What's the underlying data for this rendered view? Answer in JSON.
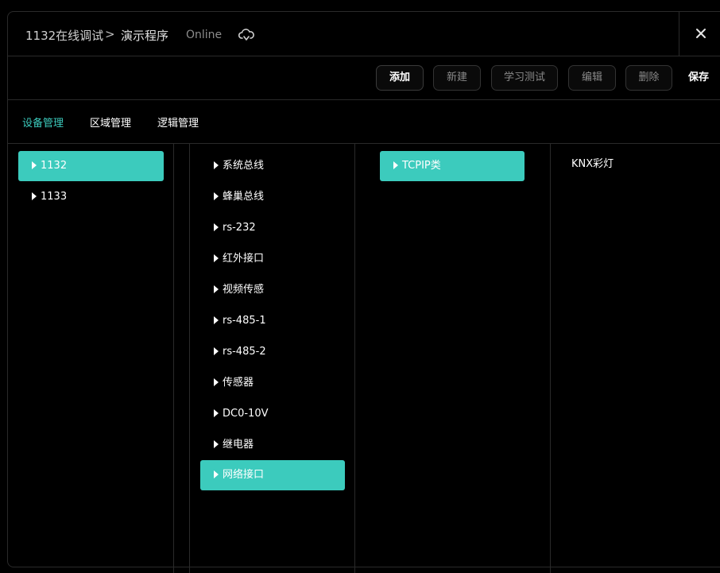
{
  "header": {
    "breadcrumb_root": "1132在线调试",
    "breadcrumb_sep": ">",
    "breadcrumb_current": "演示程序",
    "status": "Online",
    "icons": {
      "cloud": "cloud-sync-icon",
      "close": "close-icon"
    }
  },
  "toolbar": {
    "add": "添加",
    "new": "新建",
    "learn_test": "学习测试",
    "edit": "编辑",
    "delete": "删除",
    "save": "保存"
  },
  "tabs": [
    {
      "label": "设备管理",
      "active": true
    },
    {
      "label": "区域管理",
      "active": false
    },
    {
      "label": "逻辑管理",
      "active": false
    }
  ],
  "columns": {
    "hosts": [
      {
        "label": "1132",
        "selected": true
      },
      {
        "label": "1133",
        "selected": false
      }
    ],
    "interfaces": [
      {
        "label": "系统总线",
        "selected": false
      },
      {
        "label": "蜂巢总线",
        "selected": false
      },
      {
        "label": "rs-232",
        "selected": false
      },
      {
        "label": "红外接口",
        "selected": false
      },
      {
        "label": "视频传感",
        "selected": false
      },
      {
        "label": "rs-485-1",
        "selected": false
      },
      {
        "label": "rs-485-2",
        "selected": false
      },
      {
        "label": "传感器",
        "selected": false
      },
      {
        "label": "DC0-10V",
        "selected": false
      },
      {
        "label": "继电器",
        "selected": false
      },
      {
        "label": "网络接口",
        "selected": true
      }
    ],
    "categories": [
      {
        "label": "TCPIP类",
        "selected": true
      }
    ],
    "devices": [
      {
        "label": "KNX彩灯",
        "selected": false
      }
    ]
  },
  "colors": {
    "accent": "#3ccbbd",
    "background": "#000000",
    "border": "#2a2a2a"
  }
}
